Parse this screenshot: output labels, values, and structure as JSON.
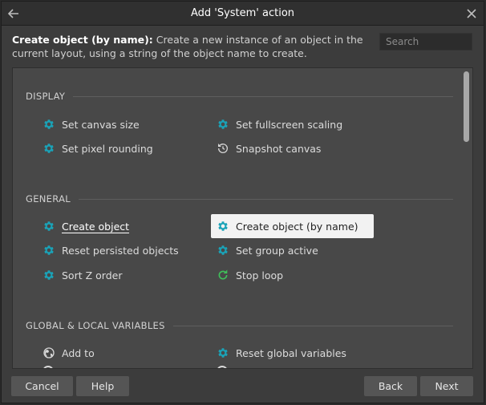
{
  "window": {
    "title": "Add 'System' action"
  },
  "description": {
    "name": "Create object (by name):",
    "text": " Create a new instance of an object in the current layout, using a string of the object name to create."
  },
  "search": {
    "placeholder": "Search"
  },
  "sections": [
    {
      "label": "DISPLAY",
      "items": [
        {
          "label": "Set canvas size",
          "icon": "gear-icon"
        },
        {
          "label": "Set fullscreen scaling",
          "icon": "gear-icon"
        },
        {
          "label": "Set pixel rounding",
          "icon": "gear-icon"
        },
        {
          "label": "Snapshot canvas",
          "icon": "history-icon"
        }
      ]
    },
    {
      "label": "GENERAL",
      "items": [
        {
          "label": "Create object",
          "icon": "gear-icon"
        },
        {
          "label": "Create object (by name)",
          "icon": "gear-icon",
          "selected": true
        },
        {
          "label": "Reset persisted objects",
          "icon": "gear-icon"
        },
        {
          "label": "Set group active",
          "icon": "gear-icon"
        },
        {
          "label": "Sort Z order",
          "icon": "gear-icon"
        },
        {
          "label": "Stop loop",
          "icon": "loop-icon"
        }
      ]
    },
    {
      "label": "GLOBAL & LOCAL VARIABLES",
      "items": [
        {
          "label": "Add to",
          "icon": "globe-icon"
        },
        {
          "label": "Reset global variables",
          "icon": "gear-icon"
        }
      ]
    }
  ],
  "footer": {
    "cancel": "Cancel",
    "help": "Help",
    "back": "Back",
    "next": "Next"
  },
  "colors": {
    "gear": "#1aa3b8",
    "loop": "#3fbf5a",
    "neutral_icon": "#d8d8d8"
  }
}
